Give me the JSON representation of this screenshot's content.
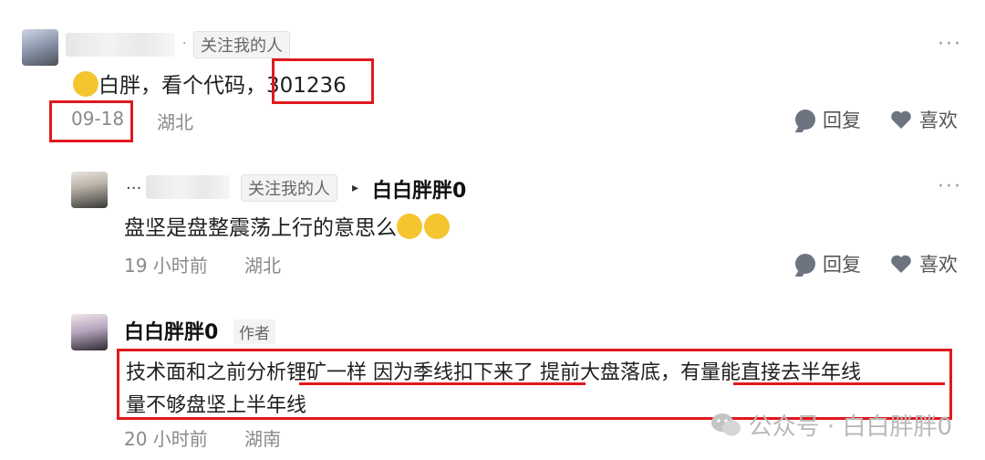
{
  "comment1": {
    "follow_tag": "关注我的人",
    "text": "白胖，看个代码，",
    "code": "301236",
    "date": "09-18",
    "location": "湖北",
    "reply_label": "回复",
    "like_label": "喜欢"
  },
  "reply1": {
    "follow_tag": "关注我的人",
    "reply_to": "白白胖胖0",
    "text": "盘坚是盘整震荡上行的意思么",
    "time": "19 小时前",
    "location": "湖北",
    "reply_label": "回复",
    "like_label": "喜欢"
  },
  "reply2": {
    "name": "白白胖胖0",
    "author_tag": "作者",
    "line1": "技术面和之前分析锂矿一样 因为季线扣下来了 提前大盘落底，有量能直接去半年线",
    "line2": "量不够盘坚上半年线",
    "time": "20 小时前",
    "location": "湖南",
    "reply_label": "回复",
    "like_label": "喜欢"
  },
  "watermark": "公众号 · 白白胖胖0",
  "more_glyph": "···",
  "colors": {
    "highlight": "#e0191e",
    "emoji": "#f5c530"
  }
}
